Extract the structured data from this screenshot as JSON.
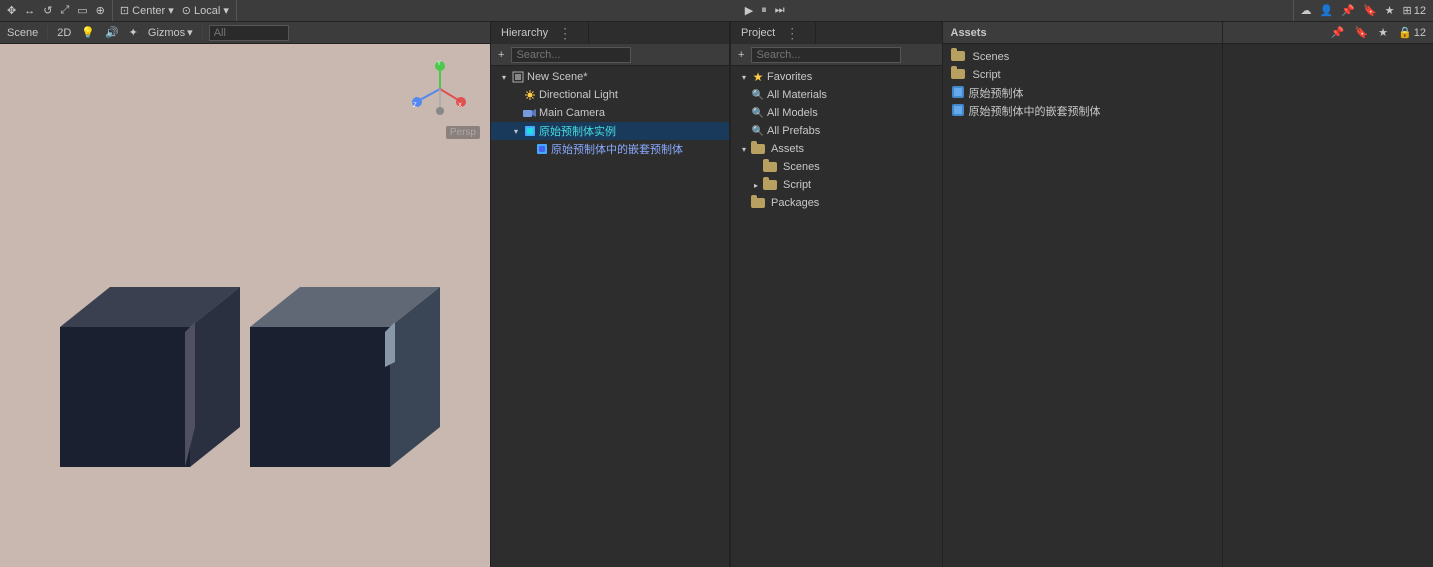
{
  "topbar": {
    "gizmos_label": "Gizmos",
    "search_placeholder": "All",
    "search2_placeholder": "All",
    "search3_placeholder": "",
    "layers_label": "▾",
    "icon12": "12"
  },
  "scene_toolbar": {
    "gizmos": "Gizmos",
    "all": "All"
  },
  "hierarchy": {
    "tab_label": "Hierarchy",
    "scene_name": "New Scene*",
    "items": [
      {
        "id": "directional-light",
        "label": "Directional Light",
        "icon": "sun",
        "indent": 1,
        "arrow": ""
      },
      {
        "id": "main-camera",
        "label": "Main Camera",
        "icon": "camera",
        "indent": 1,
        "arrow": ""
      },
      {
        "id": "prefab-instance",
        "label": "原始预制体实例",
        "icon": "prefab",
        "indent": 1,
        "arrow": "▾",
        "color": "cyan"
      },
      {
        "id": "nested-prefab",
        "label": "原始预制体中的嵌套预制体",
        "icon": "prefab",
        "indent": 2,
        "arrow": "",
        "color": "blue"
      }
    ]
  },
  "project": {
    "tab_label": "Project",
    "favorites": {
      "label": "Favorites",
      "items": [
        {
          "id": "all-materials",
          "label": "All Materials",
          "icon": "search"
        },
        {
          "id": "all-models",
          "label": "All Models",
          "icon": "search"
        },
        {
          "id": "all-prefabs",
          "label": "All Prefabs",
          "icon": "search"
        }
      ]
    },
    "assets": {
      "label": "Assets",
      "items": [
        {
          "id": "scenes",
          "label": "Scenes",
          "icon": "folder"
        },
        {
          "id": "script",
          "label": "Script",
          "icon": "folder",
          "indent": 1
        },
        {
          "id": "packages",
          "label": "Packages",
          "icon": "folder"
        }
      ]
    }
  },
  "assets_panel": {
    "header": "Assets",
    "items": [
      {
        "id": "scenes",
        "label": "Scenes",
        "icon": "folder"
      },
      {
        "id": "script",
        "label": "Script",
        "icon": "folder"
      },
      {
        "id": "prefab1",
        "label": "原始预制体",
        "icon": "prefab-blue"
      },
      {
        "id": "prefab2",
        "label": "原始预制体中的嵌套预制体",
        "icon": "prefab-blue"
      }
    ]
  },
  "toolbar_icons": {
    "transform": "✥",
    "move": "↔",
    "rotate": "↺",
    "scale": "⤢",
    "rect": "▭",
    "center": "⊕",
    "play": "▶",
    "pause": "⏸",
    "step": "⏭",
    "pin": "📌",
    "bookmark": "🔖",
    "star": "★",
    "lock": "🔒",
    "count": "12"
  }
}
